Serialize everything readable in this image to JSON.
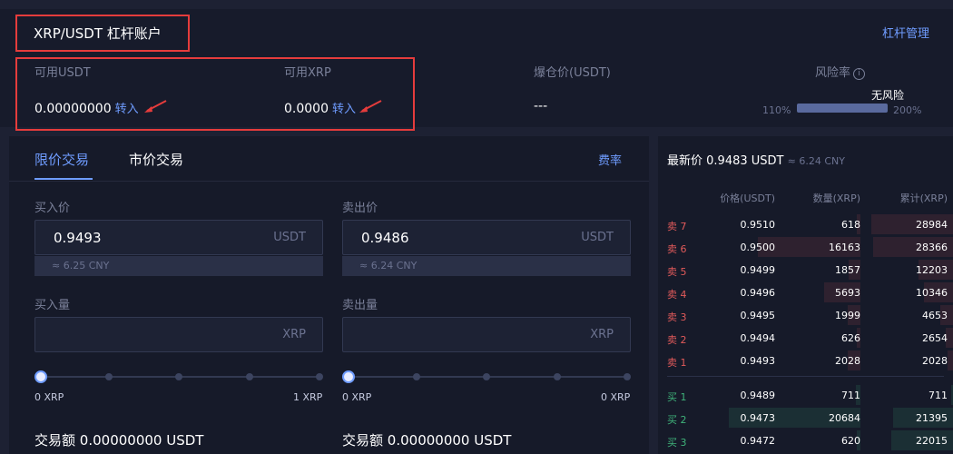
{
  "header": {
    "title": "XRP/USDT 杠杆账户",
    "leverage_management": "杠杆管理",
    "available_usdt_label": "可用USDT",
    "available_usdt_value": "0.00000000",
    "available_xrp_label": "可用XRP",
    "available_xrp_value": "0.0000",
    "transfer_in": "转入",
    "liquidation_price_label": "爆仓价(USDT)",
    "liquidation_price_value": "---",
    "risk_rate_label": "风险率",
    "risk_status": "无风险",
    "risk_min": "110%",
    "risk_max": "200%",
    "risk_info_icon": "info-icon"
  },
  "trade": {
    "tabs": [
      "限价交易",
      "市价交易"
    ],
    "active_tab": "限价交易",
    "fee_label": "费率",
    "buy": {
      "price_label": "买入价",
      "price_value": "0.9493",
      "price_unit": "USDT",
      "price_cny": "≈ 6.25 CNY",
      "amount_label": "买入量",
      "amount_value": "",
      "amount_unit": "XRP",
      "slider_min": "0 XRP",
      "slider_max": "1 XRP",
      "slider_level": 0,
      "total_label": "交易额",
      "total_value": "0.00000000 USDT"
    },
    "sell": {
      "price_label": "卖出价",
      "price_value": "0.9486",
      "price_unit": "USDT",
      "price_cny": "≈ 6.24 CNY",
      "amount_label": "卖出量",
      "amount_value": "",
      "amount_unit": "XRP",
      "slider_min": "0 XRP",
      "slider_max": "0 XRP",
      "slider_level": 0,
      "total_label": "交易额",
      "total_value": "0.00000000 USDT"
    }
  },
  "orderbook": {
    "latest_label": "最新价",
    "latest_price": "0.9483 USDT",
    "latest_cny": "≈ 6.24 CNY",
    "headers": {
      "price": "价格(USDT)",
      "quantity": "数量(XRP)",
      "cumulative": "累计(XRP)"
    },
    "asks": [
      {
        "side": "卖 7",
        "price": "0.9510",
        "quantity": "618",
        "cumulative": "28984"
      },
      {
        "side": "卖 6",
        "price": "0.9500",
        "quantity": "16163",
        "cumulative": "28366"
      },
      {
        "side": "卖 5",
        "price": "0.9499",
        "quantity": "1857",
        "cumulative": "12203"
      },
      {
        "side": "卖 4",
        "price": "0.9496",
        "quantity": "5693",
        "cumulative": "10346"
      },
      {
        "side": "卖 3",
        "price": "0.9495",
        "quantity": "1999",
        "cumulative": "4653"
      },
      {
        "side": "卖 2",
        "price": "0.9494",
        "quantity": "626",
        "cumulative": "2654"
      },
      {
        "side": "卖 1",
        "price": "0.9493",
        "quantity": "2028",
        "cumulative": "2028"
      }
    ],
    "bids": [
      {
        "side": "买 1",
        "price": "0.9489",
        "quantity": "711",
        "cumulative": "711"
      },
      {
        "side": "买 2",
        "price": "0.9473",
        "quantity": "20684",
        "cumulative": "21395"
      },
      {
        "side": "买 3",
        "price": "0.9472",
        "quantity": "620",
        "cumulative": "22015"
      }
    ]
  },
  "colors": {
    "accent": "#6f9cff",
    "ask": "#e15a5a",
    "bid": "#3fb37a",
    "annotation": "#e53c3c"
  }
}
